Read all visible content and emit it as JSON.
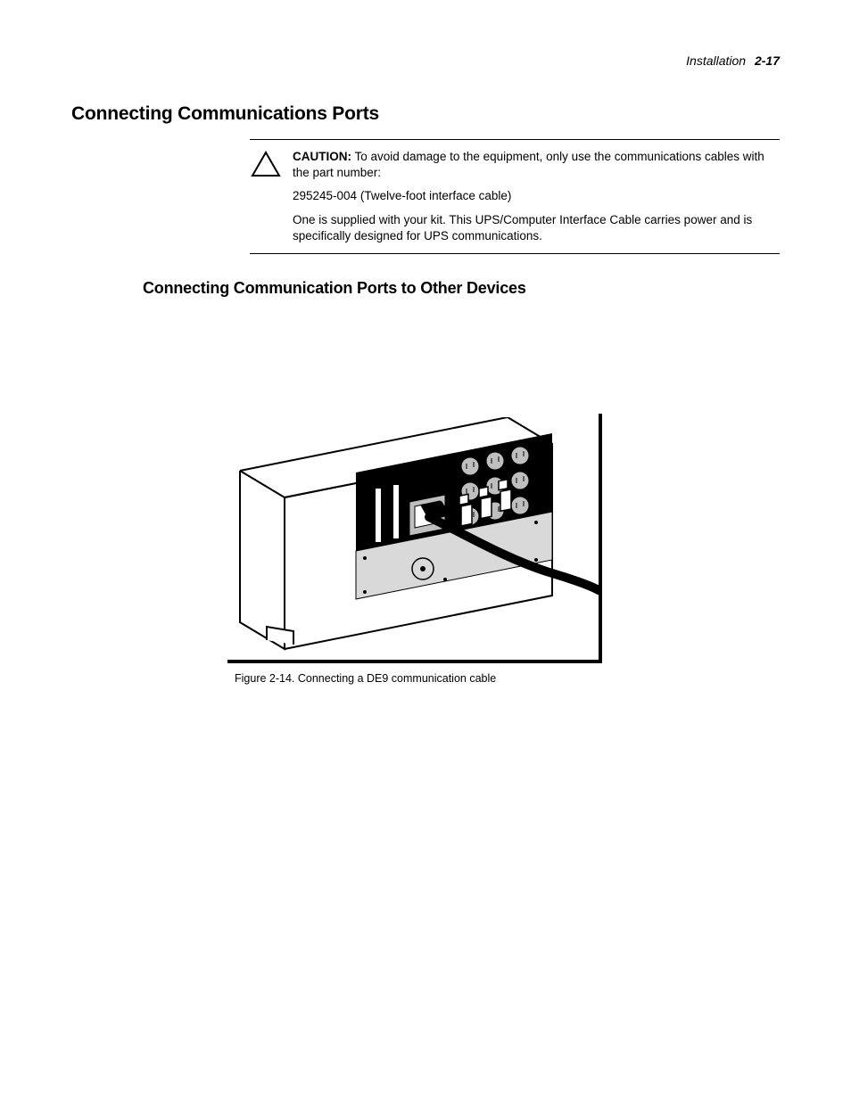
{
  "header": {
    "section": "Installation",
    "page": "2-17"
  },
  "headings": {
    "h1": "Connecting Communications Ports",
    "h2": "Connecting Communication Ports to Other Devices"
  },
  "caution": {
    "label": "CAUTION:",
    "p1_after_label": " To avoid damage to the equipment, only use the communications cables with the part number:",
    "p2": "295245-004  (Twelve-foot interface cable)",
    "p3": "One is supplied with your kit. This UPS/Computer Interface Cable carries power and is specifically designed for UPS communications."
  },
  "figure": {
    "caption": "Figure 2-14.  Connecting a DE9 communication cable"
  }
}
